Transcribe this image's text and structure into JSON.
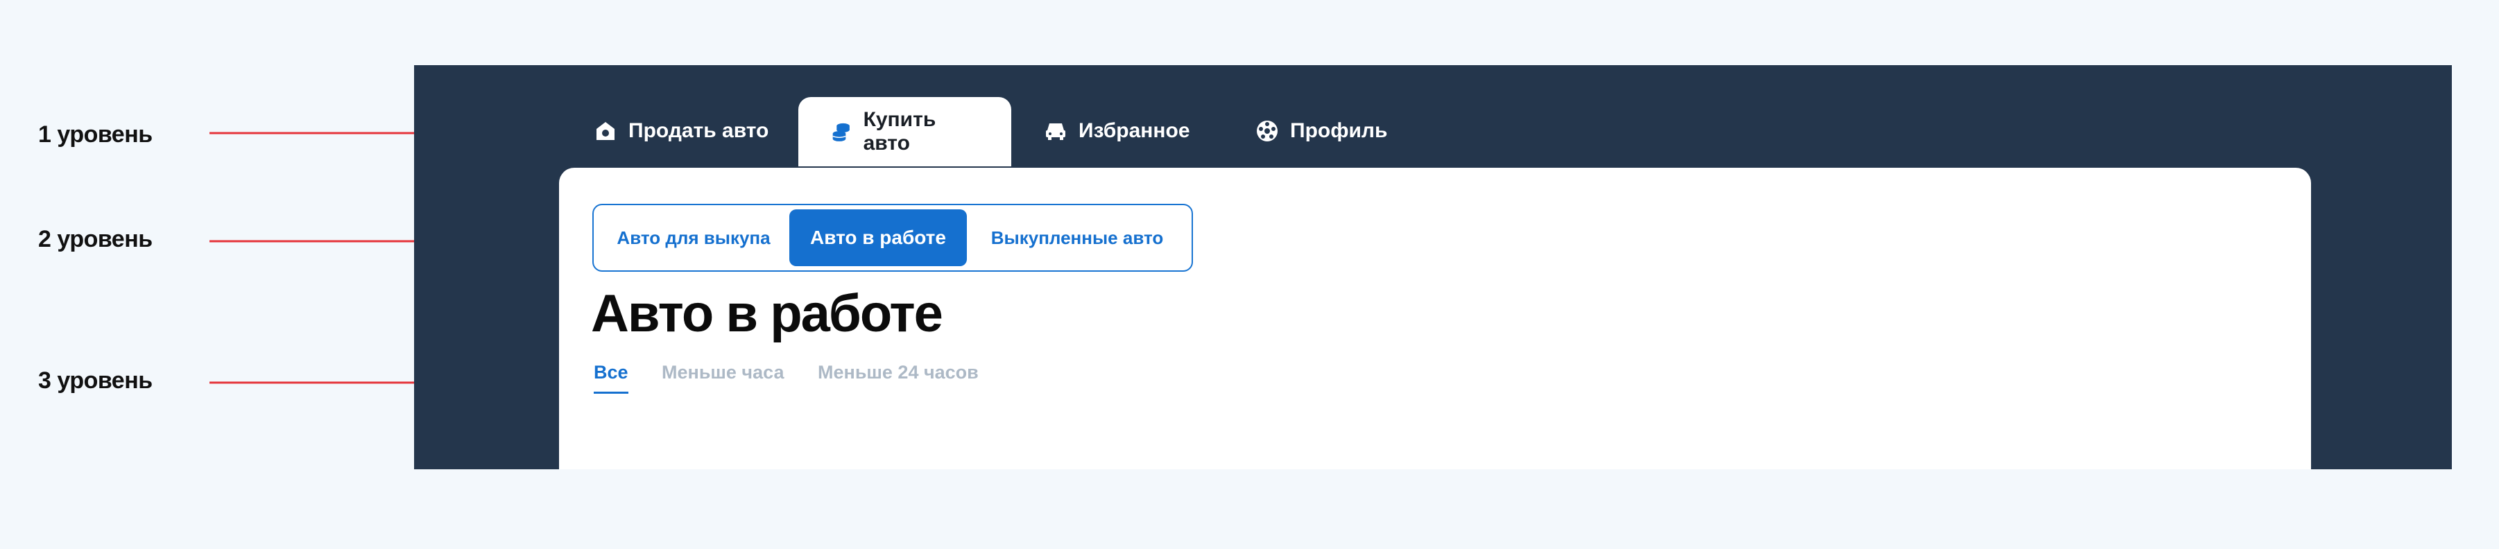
{
  "annotations": {
    "levels": [
      {
        "label": "1 уровень"
      },
      {
        "label": "2 уровень"
      },
      {
        "label": "3 уровень"
      }
    ],
    "arrow_color": "#e5343a"
  },
  "nav": {
    "tabs": [
      {
        "label": "Продать авто",
        "icon": "house-camera-icon",
        "active": false
      },
      {
        "label": "Купить авто",
        "icon": "coins-stack-icon",
        "active": true
      },
      {
        "label": "Избранное",
        "icon": "car-icon",
        "active": false
      },
      {
        "label": "Профиль",
        "icon": "gear-profile-icon",
        "active": false
      }
    ]
  },
  "subnav": {
    "items": [
      {
        "label": "Авто для выкупа",
        "active": false
      },
      {
        "label": "Авто в работе",
        "active": true
      },
      {
        "label": "Выкупленные авто",
        "active": false
      }
    ]
  },
  "page": {
    "title": "Авто в работе"
  },
  "filters": {
    "items": [
      {
        "label": "Все",
        "active": true
      },
      {
        "label": "Меньше часа",
        "active": false
      },
      {
        "label": "Меньше 24 часов",
        "active": false
      }
    ]
  },
  "colors": {
    "page_background": "#f3f8fc",
    "app_dark": "#24364c",
    "accent_blue": "#1570cf",
    "inactive_filter": "#adb9c6"
  }
}
